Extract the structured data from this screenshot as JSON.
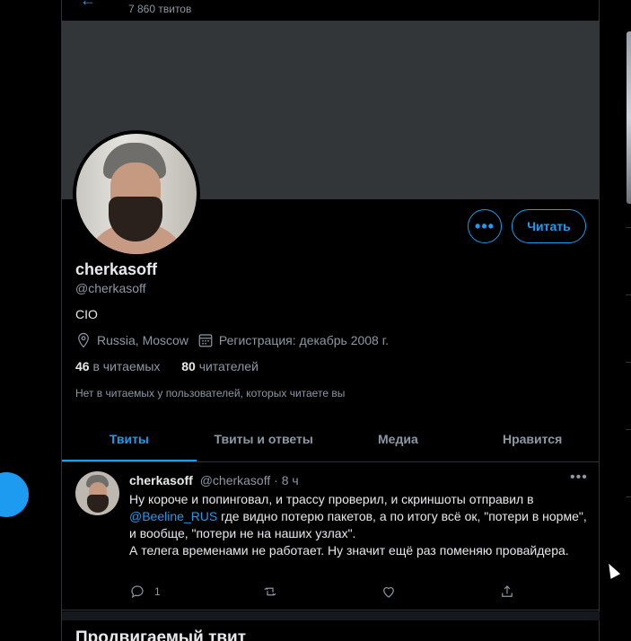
{
  "header": {
    "tweet_count": "7 860 твитов"
  },
  "profile": {
    "name": "cherkasoff",
    "handle": "@cherkasoff",
    "bio": "CIO",
    "location": "Russia, Moscow",
    "joined": "Регистрация: декабрь 2008 г.",
    "following_count": "46",
    "following_label": "в читаемых",
    "followers_count": "80",
    "followers_label": "читателей",
    "notice": "Нет в читаемых у пользователей, которых читаете вы"
  },
  "actions": {
    "more": "•••",
    "follow": "Читать"
  },
  "tabs": [
    {
      "label": "Твиты",
      "active": true
    },
    {
      "label": "Твиты и ответы",
      "active": false
    },
    {
      "label": "Медиа",
      "active": false
    },
    {
      "label": "Нравится",
      "active": false
    }
  ],
  "tweet": {
    "name": "cherkasoff",
    "handle": "@cherkasoff",
    "time": "· 8 ч",
    "more": "•••",
    "text_part1": "Ну короче и попинговал, и трассу проверил, и скриншоты отправил в ",
    "mention": "@Beeline_RUS",
    "text_part2": " где видно потерю пакетов, а по итогу всё ок, \"потери в норме\", и вообще, \"потери не на наших узлах\".",
    "text_part3": "А телега временами не работает. Ну значит ещё раз поменяю провайдера.",
    "reply_count": "1",
    "retweet_count": "",
    "like_count": ""
  },
  "promoted": {
    "title": "Продвигаемый твит"
  },
  "colors": {
    "accent": "#1d9bf0",
    "background": "#000000",
    "banner": "#333639",
    "muted": "#8b98a5"
  }
}
